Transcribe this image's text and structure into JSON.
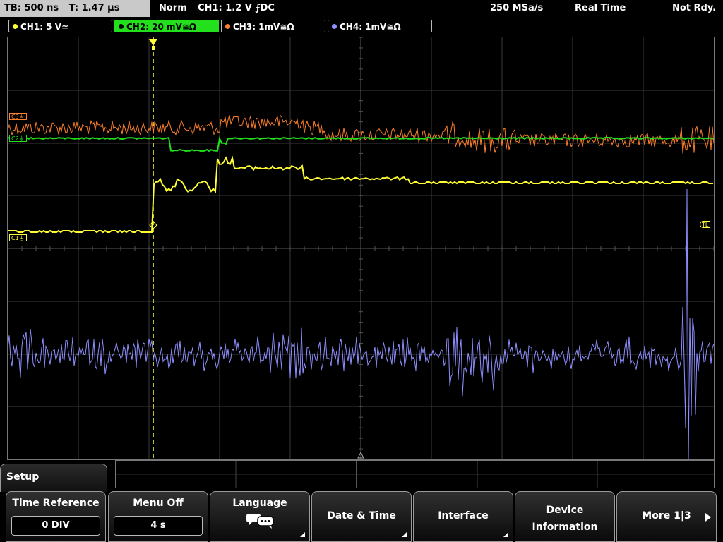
{
  "header": {
    "timebase": "TB: 500 ns",
    "trigger_time": "T: 1.47 µs",
    "mode": "Norm",
    "trigger_info": "CH1: 1.2 V ⨍DC",
    "sample_rate": "250 MSa/s",
    "acq_mode": "Real Time",
    "status": "Not Rdy."
  },
  "channels": [
    {
      "label": "CH1: 5 V≃",
      "color": "#ffff33"
    },
    {
      "label": "CH2: 20 mV≅Ω",
      "color": "#22e01c",
      "active": true
    },
    {
      "label": "CH3: 1mV≅Ω",
      "color": "#ff7f2a"
    },
    {
      "label": "CH4: 1mV≅Ω",
      "color": "#8f8fff"
    }
  ],
  "markers": {
    "c3": "C3⏚",
    "c2": "C2⏚",
    "c1": "C1⏚",
    "trigger_level": "TL"
  },
  "menu": {
    "title": "Setup",
    "keys": [
      {
        "label": "Time Reference",
        "value": "0 DIV"
      },
      {
        "label": "Menu Off",
        "value": "4 s"
      },
      {
        "label": "Language",
        "icon": "speech-bubbles-icon"
      },
      {
        "label": "Date & Time"
      },
      {
        "label": "Interface"
      },
      {
        "label_line1": "Device",
        "label_line2": "Information"
      },
      {
        "label": "More 1|3"
      }
    ]
  }
}
